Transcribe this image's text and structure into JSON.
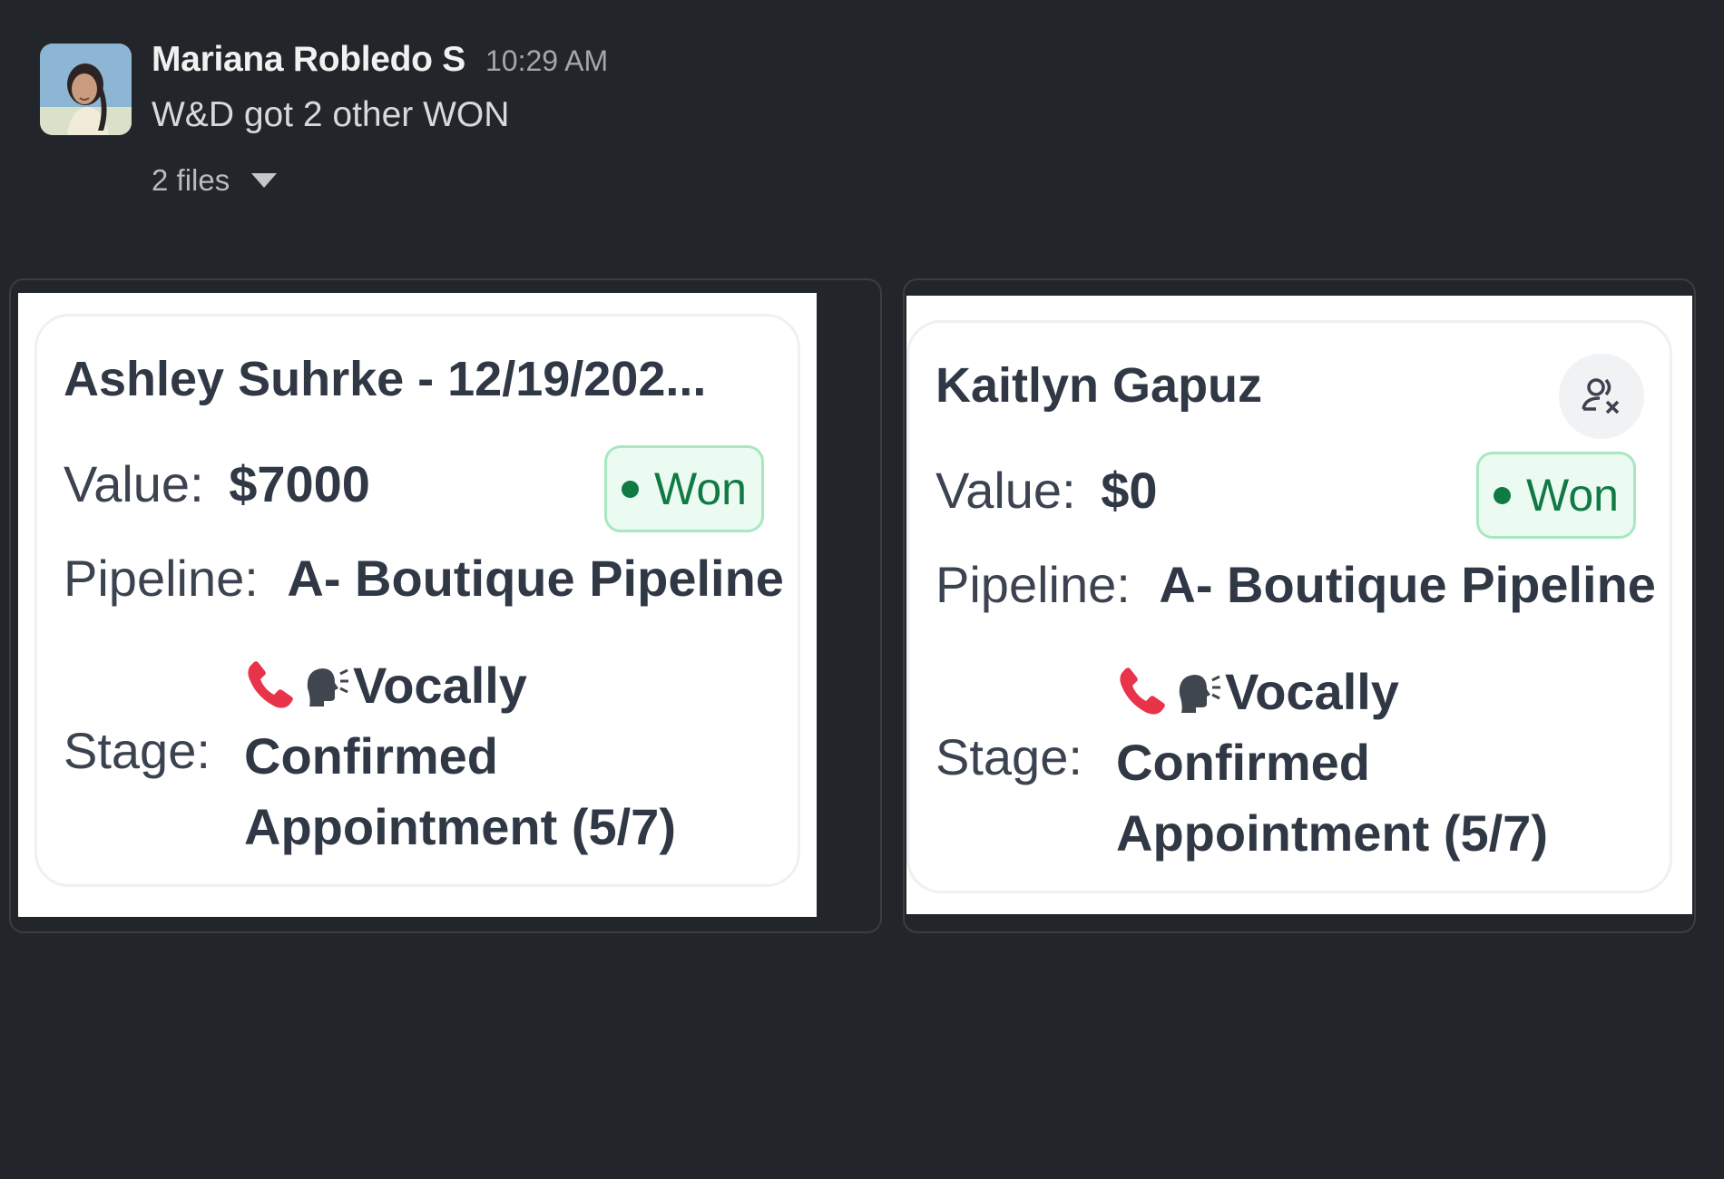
{
  "message": {
    "sender": "Mariana Robledo S",
    "timestamp": "10:29 AM",
    "text": "W&D got 2 other WON",
    "files_label": "2 files"
  },
  "icons": {
    "avatar": "user-avatar-photo",
    "files_toggle": "caret-down-icon",
    "phone": "red-phone-icon",
    "speaking": "speaking-head-icon",
    "assign": "unassign-user-icon"
  },
  "colors": {
    "background": "#222529",
    "badge_won": "#107a45",
    "badge_won_bg": "#ecfbf2",
    "badge_won_border": "#a7e8c1"
  },
  "attachments": [
    {
      "title": "Ashley Suhrke - 12/19/202...",
      "value_label": "Value:",
      "value": "$7000",
      "status": "Won",
      "pipeline_label": "Pipeline:",
      "pipeline": "A- Boutique Pipeline",
      "stage_label": "Stage:",
      "stage_line1": "Vocally",
      "stage_line2": "Confirmed",
      "stage_line3": "Appointment (5/7)"
    },
    {
      "title": "Kaitlyn Gapuz",
      "value_label": "Value:",
      "value": "$0",
      "status": "Won",
      "pipeline_label": "Pipeline:",
      "pipeline": "A- Boutique Pipeline",
      "stage_label": "Stage:",
      "stage_line1": "Vocally",
      "stage_line2": "Confirmed",
      "stage_line3": "Appointment (5/7)"
    }
  ]
}
